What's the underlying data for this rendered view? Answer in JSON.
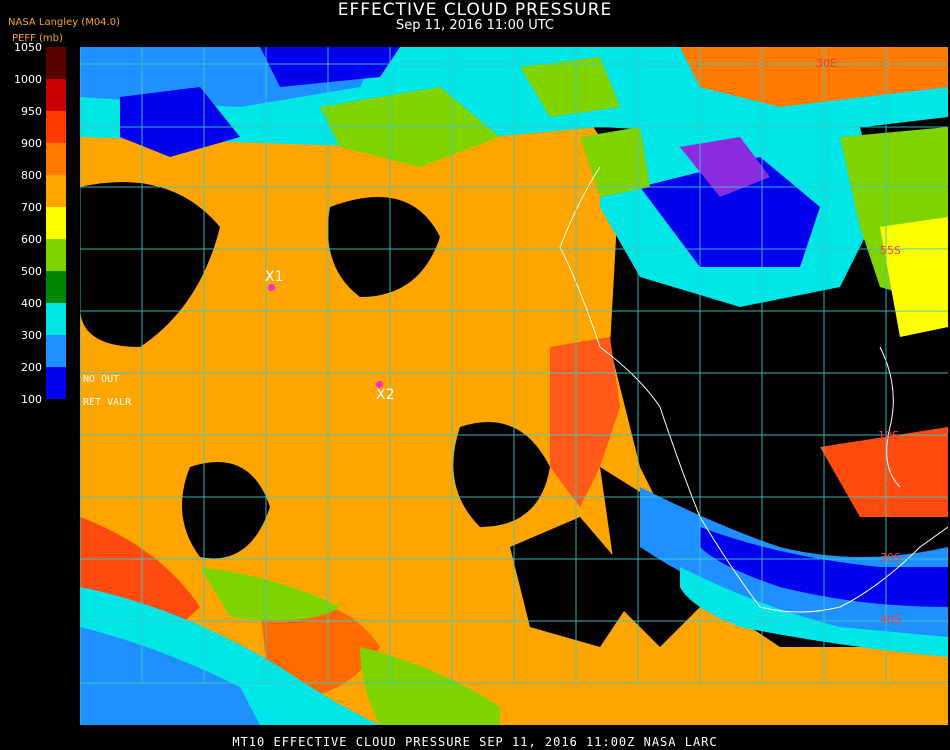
{
  "header": {
    "title": "EFFECTIVE CLOUD PRESSURE",
    "datetime": "Sep 11, 2016 11:00 UTC",
    "org": "NASA Langley (M04.0)",
    "unit": "PEFF (mb)"
  },
  "colorbar": {
    "ticks": [
      "1050",
      "1000",
      "950",
      "900",
      "800",
      "700",
      "600",
      "500",
      "400",
      "300",
      "200",
      "100"
    ],
    "colors": [
      "#5a0000",
      "#cc0000",
      "#ff3a00",
      "#ff7a00",
      "#ffa500",
      "#ffff00",
      "#7fd400",
      "#008800",
      "#00e5e5",
      "#1e90ff",
      "#0000ee",
      "#8a2be2"
    ]
  },
  "legend_notes": {
    "no_out": "NO   OUT",
    "ret_valr": "RET  VALR"
  },
  "lat_labels": [
    "55S",
    "10S",
    "30S",
    "40S",
    "30E"
  ],
  "markers": [
    {
      "label": "X1"
    },
    {
      "label": "X2"
    }
  ],
  "footer": "MT10   EFFECTIVE CLOUD PRESSURE   SEP 11, 2016 11:00Z   NASA LARC"
}
